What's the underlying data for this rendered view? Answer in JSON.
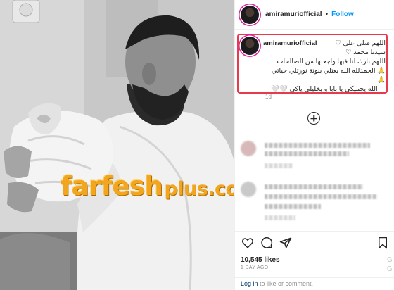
{
  "post": {
    "username": "amiramuriofficial",
    "separator": "•",
    "follow_label": "Follow",
    "caption_lines": [
      "اللهم صلي علي ♡",
      "سيدنا محمد ♡",
      "اللهم بارك لنا فيها واجعلها من الصالحات",
      "🙏 الحمدلله الله يعتلي بنوتة نورتلي حياتي",
      "🙏",
      "الله يحميكي يا بابا و يخليلي ياكي 🤍🤍"
    ],
    "caption_time": "1d",
    "likes": "10,545 likes",
    "date": "1 DAY AGO",
    "login_link": "Log in",
    "login_rest": " to like or comment.",
    "corner_glyph": "G"
  },
  "watermark": {
    "main": "farfesh",
    "sub": "plus.com"
  },
  "icons": {
    "add_comment": "plus-circle-icon",
    "like": "heart-icon",
    "comment": "comment-icon",
    "share": "share-icon",
    "save": "bookmark-icon"
  },
  "colors": {
    "accent_blue": "#0095f6",
    "highlight_red": "#e83a4a",
    "watermark_orange": "#f2a51f"
  }
}
